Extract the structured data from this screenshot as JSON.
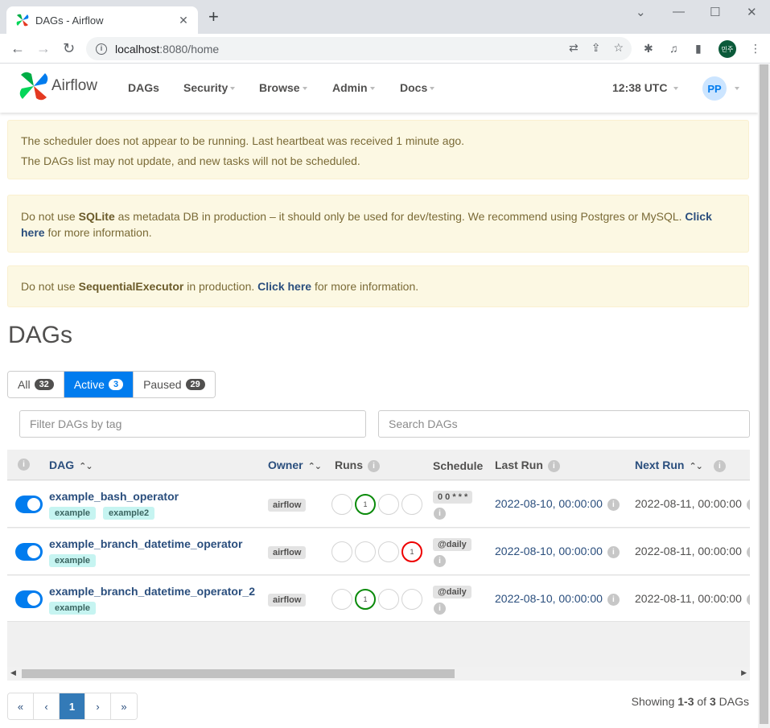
{
  "browser": {
    "tab_title": "DAGs - Airflow",
    "url_host": "localhost",
    "url_rest": ":8080/home",
    "profile_label": "민주"
  },
  "nav": {
    "brand": "Airflow",
    "menu": [
      "DAGs",
      "Security",
      "Browse",
      "Admin",
      "Docs"
    ],
    "clock": "12:38 UTC",
    "avatar": "PP"
  },
  "alerts": {
    "scheduler_line1": "The scheduler does not appear to be running. Last heartbeat was received 1 minute ago.",
    "scheduler_line2": "The DAGs list may not update, and new tasks will not be scheduled.",
    "sqlite_pre": "Do not use ",
    "sqlite_bold": "SQLite",
    "sqlite_mid": " as metadata DB in production – it should only be used for dev/testing. We recommend using Postgres or MySQL. ",
    "sqlite_link": "Click here",
    "sqlite_post": " for more information.",
    "exec_pre": "Do not use ",
    "exec_bold": "SequentialExecutor",
    "exec_mid": " in production. ",
    "exec_link": "Click here",
    "exec_post": " for more information."
  },
  "page": {
    "title": "DAGs",
    "filters": [
      {
        "label": "All",
        "count": "32"
      },
      {
        "label": "Active",
        "count": "3"
      },
      {
        "label": "Paused",
        "count": "29"
      }
    ],
    "tag_filter_placeholder": "Filter DAGs by tag",
    "search_placeholder": "Search DAGs"
  },
  "table": {
    "headers": {
      "dag": "DAG",
      "owner": "Owner",
      "runs": "Runs",
      "schedule": "Schedule",
      "last_run": "Last Run",
      "next_run": "Next Run"
    },
    "rows": [
      {
        "name": "example_bash_operator",
        "tags": [
          "example",
          "example2"
        ],
        "owner": "airflow",
        "runs": [
          {
            "label": "",
            "state": "none"
          },
          {
            "label": "1",
            "state": "success"
          },
          {
            "label": "",
            "state": "none"
          },
          {
            "label": "",
            "state": "none"
          }
        ],
        "schedule": "0 0 * * *",
        "last_run": "2022-08-10, 00:00:00",
        "next_run": "2022-08-11, 00:00:00"
      },
      {
        "name": "example_branch_datetime_operator",
        "tags": [
          "example"
        ],
        "owner": "airflow",
        "runs": [
          {
            "label": "",
            "state": "none"
          },
          {
            "label": "",
            "state": "none"
          },
          {
            "label": "",
            "state": "none"
          },
          {
            "label": "1",
            "state": "failed"
          }
        ],
        "schedule": "@daily",
        "last_run": "2022-08-10, 00:00:00",
        "next_run": "2022-08-11, 00:00:00"
      },
      {
        "name": "example_branch_datetime_operator_2",
        "tags": [
          "example"
        ],
        "owner": "airflow",
        "runs": [
          {
            "label": "",
            "state": "none"
          },
          {
            "label": "1",
            "state": "success"
          },
          {
            "label": "",
            "state": "none"
          },
          {
            "label": "",
            "state": "none"
          }
        ],
        "schedule": "@daily",
        "last_run": "2022-08-10, 00:00:00",
        "next_run": "2022-08-11, 00:00:00"
      }
    ]
  },
  "pagination": {
    "first": "«",
    "prev": "‹",
    "current": "1",
    "next": "›",
    "last": "»",
    "showing_pre": "Showing ",
    "showing_range": "1-3",
    "showing_mid": " of ",
    "showing_total": "3",
    "showing_post": " DAGs"
  },
  "colors": {
    "accent": "#017cee",
    "success": "#0a8a0a",
    "failed": "#ee0000"
  }
}
